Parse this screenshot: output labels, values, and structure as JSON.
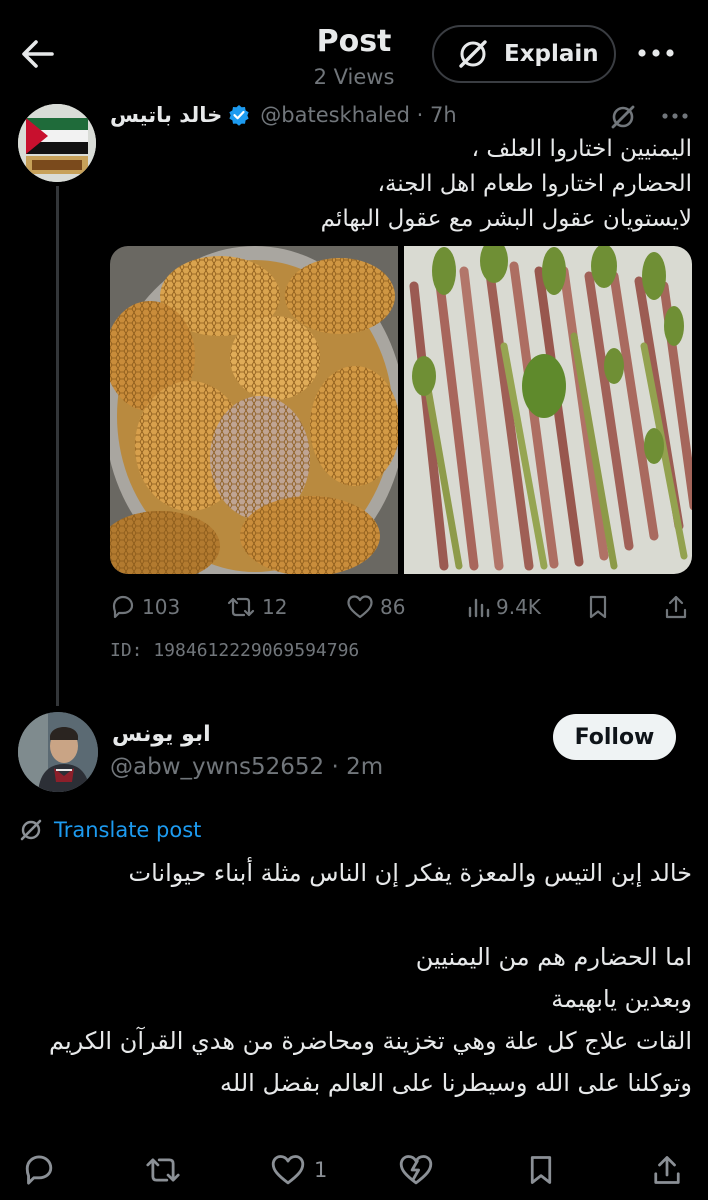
{
  "header": {
    "title": "Post",
    "views": "2 Views",
    "explain_label": "Explain"
  },
  "original_post": {
    "author_name": "خالد باتيس",
    "handle_time": "@bateskhaled · 7h",
    "text_lines": [
      "اليمنيين اختاروا العلف ،",
      "الحضارم اختاروا طعام اهل الجنة،",
      "لايستويان عقول البشر مع عقول البهائم"
    ],
    "media": [
      "honeycomb",
      "khat-bundles"
    ],
    "actions": {
      "replies": "103",
      "reposts": "12",
      "likes": "86",
      "views": "9.4K"
    },
    "id_label": "ID: 1984612229069594796"
  },
  "reply": {
    "author_name": "ابو يونس",
    "handle_time": "@abw_ywns52652 · 2m",
    "follow_label": "Follow",
    "translate_label": "Translate post",
    "text": "خالد إبن التيس والمعزة يفكر إن الناس مثلة أبناء حيوانات\n\nاما الحضارم هم من اليمنيين\nوبعدين يابهيمة\nالقات علاج كل علة وهي تخزينة ومحاضرة من هدي القرآن الكريم وتوكلنا على الله وسيطرنا على العالم بفضل الله",
    "actions": {
      "likes": "1"
    }
  },
  "colors": {
    "background": "#000000",
    "text": "#e7e9ea",
    "muted": "#71767b",
    "accent": "#1d9bf0",
    "verified": "#1d9bf0"
  },
  "icons": [
    "back-arrow-icon",
    "grok-icon",
    "more-icon",
    "verified-badge-icon",
    "reply-icon",
    "repost-icon",
    "like-icon",
    "views-icon",
    "bookmark-icon",
    "share-icon",
    "translate-icon",
    "grok-feature-icon"
  ]
}
